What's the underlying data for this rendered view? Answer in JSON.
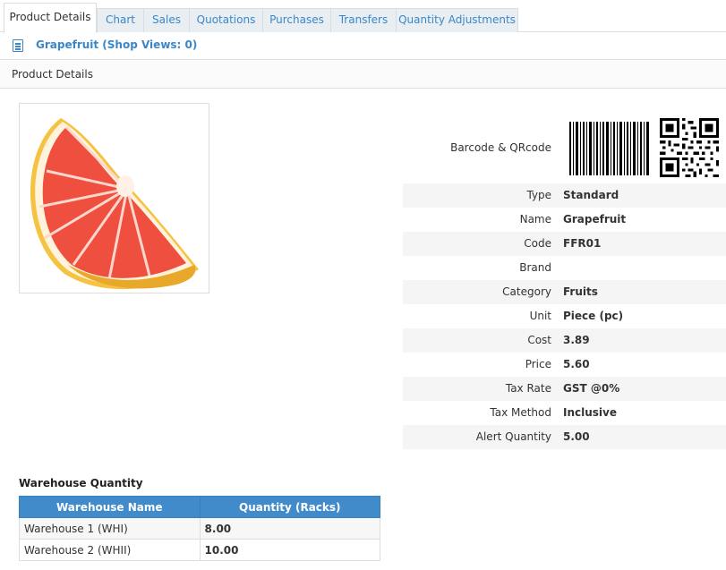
{
  "tabs": [
    {
      "label": "Product Details",
      "active": true
    },
    {
      "label": "Chart"
    },
    {
      "label": "Sales"
    },
    {
      "label": "Quotations"
    },
    {
      "label": "Purchases"
    },
    {
      "label": "Transfers"
    },
    {
      "label": "Quantity Adjustments"
    }
  ],
  "header": {
    "title": "Grapefruit (Shop Views: 0)",
    "icon": "document-icon"
  },
  "subheader": {
    "title": "Product Details"
  },
  "barcode_label": "Barcode & QRcode",
  "details": [
    {
      "label": "Type",
      "value": "Standard"
    },
    {
      "label": "Name",
      "value": "Grapefruit"
    },
    {
      "label": "Code",
      "value": "FFR01"
    },
    {
      "label": "Brand",
      "value": ""
    },
    {
      "label": "Category",
      "value": "Fruits"
    },
    {
      "label": "Unit",
      "value": "Piece (pc)"
    },
    {
      "label": "Cost",
      "value": "3.89"
    },
    {
      "label": "Price",
      "value": "5.60"
    },
    {
      "label": "Tax Rate",
      "value": "GST @0%"
    },
    {
      "label": "Tax Method",
      "value": "Inclusive"
    },
    {
      "label": "Alert Quantity",
      "value": "5.00"
    }
  ],
  "warehouse": {
    "title": "Warehouse Quantity",
    "columns": [
      "Warehouse Name",
      "Quantity (Racks)"
    ],
    "rows": [
      {
        "name": "Warehouse 1 (WHI)",
        "qty": "8.00"
      },
      {
        "name": "Warehouse 2 (WHII)",
        "qty": "10.00"
      }
    ]
  },
  "colors": {
    "accent": "#3a87c8",
    "table_header": "#428bca"
  }
}
